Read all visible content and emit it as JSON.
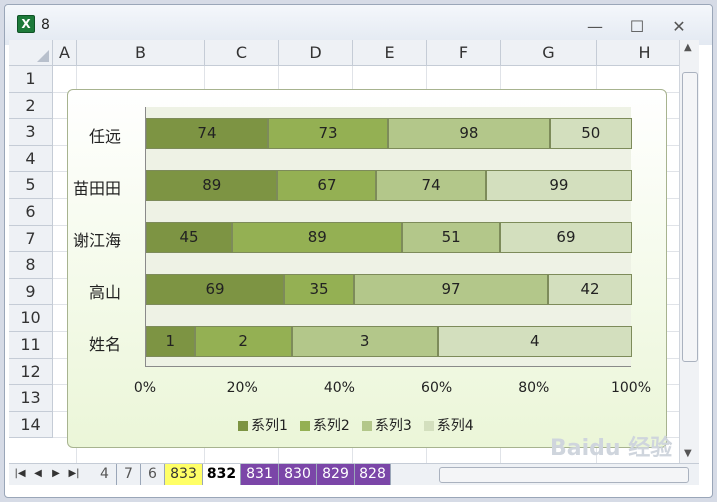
{
  "window": {
    "title": "8",
    "app_icon": "excel-icon"
  },
  "columns": [
    "A",
    "B",
    "C",
    "D",
    "E",
    "F",
    "G",
    "H"
  ],
  "rows": [
    "1",
    "2",
    "3",
    "4",
    "5",
    "6",
    "7",
    "8",
    "9",
    "10",
    "11",
    "12",
    "13",
    "14"
  ],
  "tabs": [
    "4",
    "7",
    "6",
    "833",
    "832",
    "831",
    "830",
    "829",
    "828"
  ],
  "active_tab": "832",
  "colors": {
    "series1": "#7d9443",
    "series2": "#94b053",
    "series3": "#b3c78a",
    "series4": "#d3dfbe",
    "tab_yellow": "#ffff66",
    "tab_purple": "#7b46a8"
  },
  "chart_data": {
    "type": "bar",
    "orientation": "horizontal",
    "stacked_percent": true,
    "categories": [
      "任远",
      "苗田田",
      "谢江海",
      "高山",
      "姓名"
    ],
    "series": [
      {
        "name": "系列1",
        "values": [
          74,
          89,
          45,
          69,
          1
        ]
      },
      {
        "name": "系列2",
        "values": [
          73,
          67,
          89,
          35,
          2
        ]
      },
      {
        "name": "系列3",
        "values": [
          98,
          74,
          51,
          97,
          3
        ]
      },
      {
        "name": "系列4",
        "values": [
          50,
          99,
          69,
          42,
          4
        ]
      }
    ],
    "x_ticks": [
      "0%",
      "20%",
      "40%",
      "60%",
      "80%",
      "100%"
    ],
    "xlim": [
      0,
      100
    ],
    "legend": "bottom"
  }
}
